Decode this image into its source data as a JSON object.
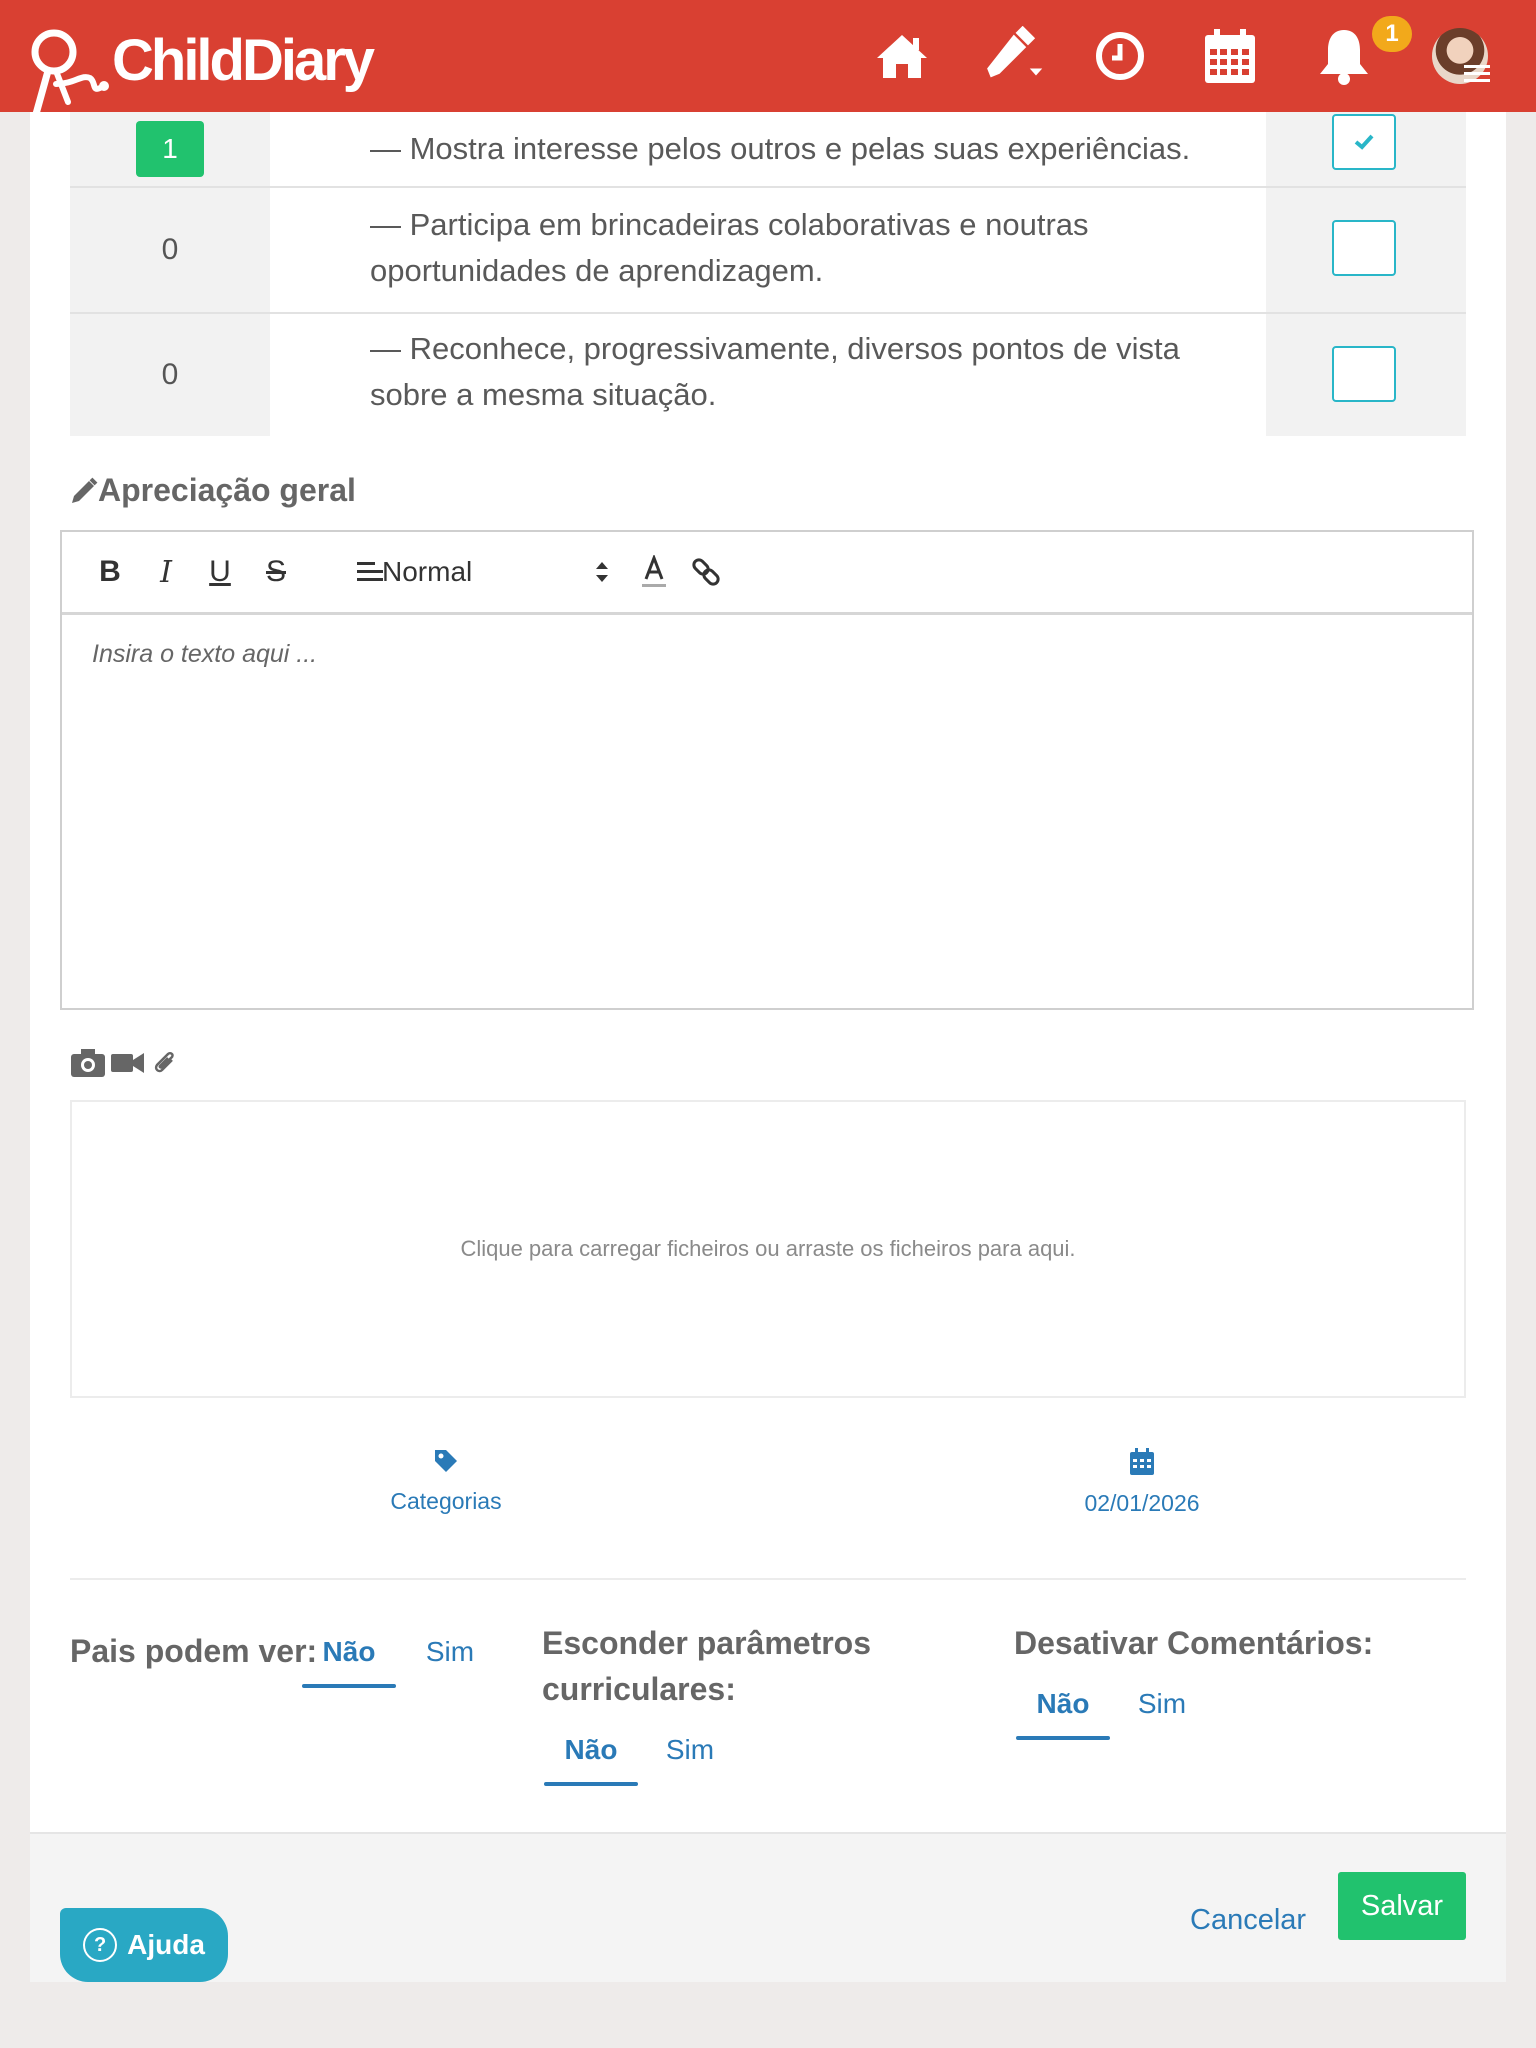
{
  "header": {
    "logo_text": "ChildDiary",
    "nav_icons": [
      "home-icon",
      "pencil-dropdown-icon",
      "clock-icon",
      "calendar-icon",
      "bell-icon"
    ],
    "notification_count": "1",
    "brand_color": "#d94032"
  },
  "criteria": {
    "rows": [
      {
        "count": "1",
        "text": "— Mostra interesse pelos outros e pelas suas experiências.",
        "checked": true
      },
      {
        "count": "0",
        "text": "— Participa em brincadeiras colaborativas e noutras oportunidades de aprendizagem.",
        "checked": false
      },
      {
        "count": "0",
        "text": "— Reconhece, progressivamente, diversos pontos de vista sobre a mesma situação.",
        "checked": false
      }
    ]
  },
  "appreciation": {
    "title": "Apreciação geral",
    "toolbar": {
      "bold": "B",
      "italic": "I",
      "underline": "U",
      "strike": "S",
      "size_select": "Normal"
    },
    "placeholder": "Insira o texto aqui ..."
  },
  "uploads": {
    "dropzone_text": "Clique para carregar ficheiros ou arraste os ficheiros para aqui."
  },
  "meta": {
    "categories_label": "Categorias",
    "date": "02/01/2026"
  },
  "options": {
    "parents_can_see": {
      "label": "Pais podem ver:",
      "no": "Não",
      "yes": "Sim",
      "selected": "Não"
    },
    "hide_params": {
      "label_line1": "Esconder parâmetros",
      "label_line2": "curriculares:",
      "no": "Não",
      "yes": "Sim",
      "selected": "Não"
    },
    "disable_comments": {
      "label": "Desativar Comentários:",
      "no": "Não",
      "yes": "Sim",
      "selected": "Não"
    }
  },
  "footer": {
    "cancel": "Cancelar",
    "save": "Salvar",
    "help": "Ajuda"
  },
  "colors": {
    "accent": "#2a7ab7",
    "success": "#21c26e",
    "checkbox": "#29b6c8",
    "help": "#29a8c4"
  }
}
